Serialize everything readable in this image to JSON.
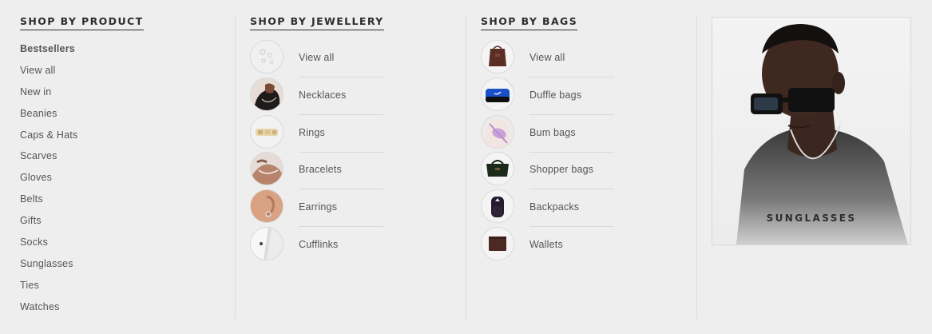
{
  "columns": {
    "product": {
      "heading": "SHOP BY PRODUCT",
      "items": [
        "Bestsellers",
        "View all",
        "New in",
        "Beanies",
        "Caps & Hats",
        "Scarves",
        "Gloves",
        "Belts",
        "Gifts",
        "Socks",
        "Sunglasses",
        "Ties",
        "Watches"
      ]
    },
    "jewellery": {
      "heading": "SHOP BY JEWELLERY",
      "items": [
        {
          "label": "View all",
          "icon": "jewellery-view-all-thumbnail"
        },
        {
          "label": "Necklaces",
          "icon": "necklace-thumbnail"
        },
        {
          "label": "Rings",
          "icon": "ring-thumbnail"
        },
        {
          "label": "Bracelets",
          "icon": "bracelet-thumbnail"
        },
        {
          "label": "Earrings",
          "icon": "earring-thumbnail"
        },
        {
          "label": "Cufflinks",
          "icon": "cufflink-thumbnail"
        }
      ]
    },
    "bags": {
      "heading": "SHOP BY BAGS",
      "items": [
        {
          "label": "View all",
          "icon": "bags-view-all-thumbnail"
        },
        {
          "label": "Duffle bags",
          "icon": "duffle-bag-thumbnail"
        },
        {
          "label": "Bum bags",
          "icon": "bum-bag-thumbnail"
        },
        {
          "label": "Shopper bags",
          "icon": "shopper-bag-thumbnail"
        },
        {
          "label": "Backpacks",
          "icon": "backpack-thumbnail"
        },
        {
          "label": "Wallets",
          "icon": "wallet-thumbnail"
        }
      ]
    }
  },
  "promo": {
    "label": "SUNGLASSES",
    "image": "model-wearing-sunglasses"
  }
}
